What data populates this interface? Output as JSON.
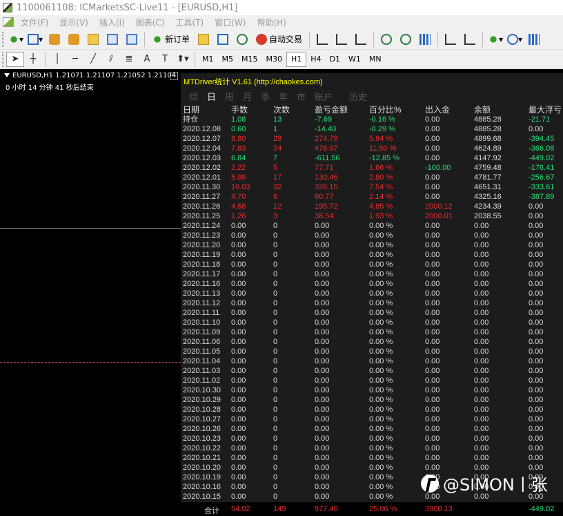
{
  "window": {
    "title": "1100061108: ICMarketsSC-Live11 - [EURUSD,H1]"
  },
  "menu": [
    "文件(F)",
    "显示(V)",
    "插入(I)",
    "图表(C)",
    "工具(T)",
    "窗口(W)",
    "帮助(H)"
  ],
  "toolbar": {
    "new_order": "新订单",
    "auto_trade": "自动交易"
  },
  "timeframes": [
    "M1",
    "M5",
    "M15",
    "M30",
    "H1",
    "H4",
    "D1",
    "W1",
    "MN"
  ],
  "active_timeframe": "H1",
  "draw_tools": {
    "text_tool": "A",
    "label_tool": "T"
  },
  "chart": {
    "header": "EURUSD,H1  1.21071 1.21107 1.21052 1.21104",
    "timer": "0 小时 14 分钟 41 秒后结束",
    "minimize": "—",
    "bull_color": "#26c6b5",
    "bear_color": "#e05a5a",
    "dash_color": "#c2476b"
  },
  "panel": {
    "title": "MTDriver统计 V1.61  (http://chaokes.com)",
    "tabs": [
      "综",
      "日",
      "周",
      "月",
      "季",
      "年",
      "市",
      "账户",
      "历史"
    ],
    "active_tab": "日",
    "columns": [
      "日期",
      "手数",
      "次数",
      "盈亏金额",
      "百分比%",
      "出入金",
      "余额",
      "最大浮亏"
    ],
    "rows": [
      {
        "date": "持仓",
        "lots": "1.08",
        "count": "13",
        "pnl": "-7.69",
        "pct": "-0.16 %",
        "io": "0.00",
        "balance": "4885.28",
        "dd": "-21.71",
        "color": "g"
      },
      {
        "date": "2020.12.08",
        "lots": "0.60",
        "count": "1",
        "pnl": "-14.40",
        "pct": "-0.29 %",
        "io": "0.00",
        "balance": "4885.28",
        "dd": "0.00",
        "color": "g"
      },
      {
        "date": "2020.12.07",
        "lots": "8.80",
        "count": "29",
        "pnl": "274.79",
        "pct": "5.94 %",
        "io": "0.00",
        "balance": "4899.68",
        "dd": "-394.45",
        "color": "r"
      },
      {
        "date": "2020.12.04",
        "lots": "7.83",
        "count": "24",
        "pnl": "476.97",
        "pct": "11.50 %",
        "io": "0.00",
        "balance": "4624.89",
        "dd": "-366.08",
        "color": "r"
      },
      {
        "date": "2020.12.03",
        "lots": "6.84",
        "count": "7",
        "pnl": "-611.56",
        "pct": "-12.85 %",
        "io": "0.00",
        "balance": "4147.92",
        "dd": "-449.02",
        "color": "g"
      },
      {
        "date": "2020.12.02",
        "lots": "2.22",
        "count": "5",
        "pnl": "77.71",
        "pct": "1.66 %",
        "io": "-100.00",
        "balance": "4759.48",
        "dd": "-176.41",
        "color": "r",
        "io_color": "g"
      },
      {
        "date": "2020.12.01",
        "lots": "5.98",
        "count": "17",
        "pnl": "130.46",
        "pct": "2.80 %",
        "io": "0.00",
        "balance": "4781.77",
        "dd": "-256.67",
        "color": "r"
      },
      {
        "date": "2020.11.30",
        "lots": "10.03",
        "count": "32",
        "pnl": "326.15",
        "pct": "7.54 %",
        "io": "0.00",
        "balance": "4651.31",
        "dd": "-333.61",
        "color": "r"
      },
      {
        "date": "2020.11.27",
        "lots": "4.70",
        "count": "6",
        "pnl": "90.77",
        "pct": "2.14 %",
        "io": "0.00",
        "balance": "4325.16",
        "dd": "-387.89",
        "color": "r"
      },
      {
        "date": "2020.11.26",
        "lots": "4.68",
        "count": "12",
        "pnl": "195.72",
        "pct": "4.85 %",
        "io": "2000.12",
        "balance": "4234.39",
        "dd": "0.00",
        "color": "r",
        "io_color": "r"
      },
      {
        "date": "2020.11.25",
        "lots": "1.26",
        "count": "3",
        "pnl": "38.54",
        "pct": "1.93 %",
        "io": "2000.01",
        "balance": "2038.55",
        "dd": "0.00",
        "color": "r",
        "io_color": "r"
      },
      {
        "date": "2020.11.24",
        "lots": "0.00",
        "count": "0",
        "pnl": "0.00",
        "pct": "0.00 %",
        "io": "0.00",
        "balance": "0.00",
        "dd": "0.00",
        "color": "w"
      },
      {
        "date": "2020.11.23",
        "lots": "0.00",
        "count": "0",
        "pnl": "0.00",
        "pct": "0.00 %",
        "io": "0.00",
        "balance": "0.00",
        "dd": "0.00",
        "color": "w"
      },
      {
        "date": "2020.11.20",
        "lots": "0.00",
        "count": "0",
        "pnl": "0.00",
        "pct": "0.00 %",
        "io": "0.00",
        "balance": "0.00",
        "dd": "0.00",
        "color": "w"
      },
      {
        "date": "2020.11.19",
        "lots": "0.00",
        "count": "0",
        "pnl": "0.00",
        "pct": "0.00 %",
        "io": "0.00",
        "balance": "0.00",
        "dd": "0.00",
        "color": "w"
      },
      {
        "date": "2020.11.18",
        "lots": "0.00",
        "count": "0",
        "pnl": "0.00",
        "pct": "0.00 %",
        "io": "0.00",
        "balance": "0.00",
        "dd": "0.00",
        "color": "w"
      },
      {
        "date": "2020.11.17",
        "lots": "0.00",
        "count": "0",
        "pnl": "0.00",
        "pct": "0.00 %",
        "io": "0.00",
        "balance": "0.00",
        "dd": "0.00",
        "color": "w"
      },
      {
        "date": "2020.11.16",
        "lots": "0.00",
        "count": "0",
        "pnl": "0.00",
        "pct": "0.00 %",
        "io": "0.00",
        "balance": "0.00",
        "dd": "0.00",
        "color": "w"
      },
      {
        "date": "2020.11.13",
        "lots": "0.00",
        "count": "0",
        "pnl": "0.00",
        "pct": "0.00 %",
        "io": "0.00",
        "balance": "0.00",
        "dd": "0.00",
        "color": "w"
      },
      {
        "date": "2020.11.12",
        "lots": "0.00",
        "count": "0",
        "pnl": "0.00",
        "pct": "0.00 %",
        "io": "0.00",
        "balance": "0.00",
        "dd": "0.00",
        "color": "w"
      },
      {
        "date": "2020.11.11",
        "lots": "0.00",
        "count": "0",
        "pnl": "0.00",
        "pct": "0.00 %",
        "io": "0.00",
        "balance": "0.00",
        "dd": "0.00",
        "color": "w"
      },
      {
        "date": "2020.11.10",
        "lots": "0.00",
        "count": "0",
        "pnl": "0.00",
        "pct": "0.00 %",
        "io": "0.00",
        "balance": "0.00",
        "dd": "0.00",
        "color": "w"
      },
      {
        "date": "2020.11.09",
        "lots": "0.00",
        "count": "0",
        "pnl": "0.00",
        "pct": "0.00 %",
        "io": "0.00",
        "balance": "0.00",
        "dd": "0.00",
        "color": "w"
      },
      {
        "date": "2020.11.06",
        "lots": "0.00",
        "count": "0",
        "pnl": "0.00",
        "pct": "0.00 %",
        "io": "0.00",
        "balance": "0.00",
        "dd": "0.00",
        "color": "w"
      },
      {
        "date": "2020.11.05",
        "lots": "0.00",
        "count": "0",
        "pnl": "0.00",
        "pct": "0.00 %",
        "io": "0.00",
        "balance": "0.00",
        "dd": "0.00",
        "color": "w"
      },
      {
        "date": "2020.11.04",
        "lots": "0.00",
        "count": "0",
        "pnl": "0.00",
        "pct": "0.00 %",
        "io": "0.00",
        "balance": "0.00",
        "dd": "0.00",
        "color": "w"
      },
      {
        "date": "2020.11.03",
        "lots": "0.00",
        "count": "0",
        "pnl": "0.00",
        "pct": "0.00 %",
        "io": "0.00",
        "balance": "0.00",
        "dd": "0.00",
        "color": "w"
      },
      {
        "date": "2020.11.02",
        "lots": "0.00",
        "count": "0",
        "pnl": "0.00",
        "pct": "0.00 %",
        "io": "0.00",
        "balance": "0.00",
        "dd": "0.00",
        "color": "w"
      },
      {
        "date": "2020.10.30",
        "lots": "0.00",
        "count": "0",
        "pnl": "0.00",
        "pct": "0.00 %",
        "io": "0.00",
        "balance": "0.00",
        "dd": "0.00",
        "color": "w"
      },
      {
        "date": "2020.10.29",
        "lots": "0.00",
        "count": "0",
        "pnl": "0.00",
        "pct": "0.00 %",
        "io": "0.00",
        "balance": "0.00",
        "dd": "0.00",
        "color": "w"
      },
      {
        "date": "2020.10.28",
        "lots": "0.00",
        "count": "0",
        "pnl": "0.00",
        "pct": "0.00 %",
        "io": "0.00",
        "balance": "0.00",
        "dd": "0.00",
        "color": "w"
      },
      {
        "date": "2020.10.27",
        "lots": "0.00",
        "count": "0",
        "pnl": "0.00",
        "pct": "0.00 %",
        "io": "0.00",
        "balance": "0.00",
        "dd": "0.00",
        "color": "w"
      },
      {
        "date": "2020.10.26",
        "lots": "0.00",
        "count": "0",
        "pnl": "0.00",
        "pct": "0.00 %",
        "io": "0.00",
        "balance": "0.00",
        "dd": "0.00",
        "color": "w"
      },
      {
        "date": "2020.10.23",
        "lots": "0.00",
        "count": "0",
        "pnl": "0.00",
        "pct": "0.00 %",
        "io": "0.00",
        "balance": "0.00",
        "dd": "0.00",
        "color": "w"
      },
      {
        "date": "2020.10.22",
        "lots": "0.00",
        "count": "0",
        "pnl": "0.00",
        "pct": "0.00 %",
        "io": "0.00",
        "balance": "0.00",
        "dd": "0.00",
        "color": "w"
      },
      {
        "date": "2020.10.21",
        "lots": "0.00",
        "count": "0",
        "pnl": "0.00",
        "pct": "0.00 %",
        "io": "0.00",
        "balance": "0.00",
        "dd": "0.00",
        "color": "w"
      },
      {
        "date": "2020.10.20",
        "lots": "0.00",
        "count": "0",
        "pnl": "0.00",
        "pct": "0.00 %",
        "io": "0.00",
        "balance": "0.00",
        "dd": "0.00",
        "color": "w"
      },
      {
        "date": "2020.10.19",
        "lots": "0.00",
        "count": "0",
        "pnl": "0.00",
        "pct": "0.00 %",
        "io": "0.00",
        "balance": "0.00",
        "dd": "0.00",
        "color": "w"
      },
      {
        "date": "2020.10.16",
        "lots": "0.00",
        "count": "0",
        "pnl": "0.00",
        "pct": "0.00 %",
        "io": "0.00",
        "balance": "0.00",
        "dd": "0.00",
        "color": "w"
      },
      {
        "date": "2020.10.15",
        "lots": "0.00",
        "count": "0",
        "pnl": "0.00",
        "pct": "0.00 %",
        "io": "0.00",
        "balance": "0.00",
        "dd": "0.00",
        "color": "w"
      }
    ],
    "summary": {
      "label": "合计",
      "lots": "54.02",
      "count": "149",
      "pnl": "977.46",
      "pct": "25.06 %",
      "io": "3900.13",
      "dd": "-449.02"
    }
  },
  "colors": {
    "green": "#29e07a",
    "red": "#e03030",
    "white": "#dddddd",
    "title_yellow": "#ffff00"
  },
  "watermark": "@SIMON丨张"
}
